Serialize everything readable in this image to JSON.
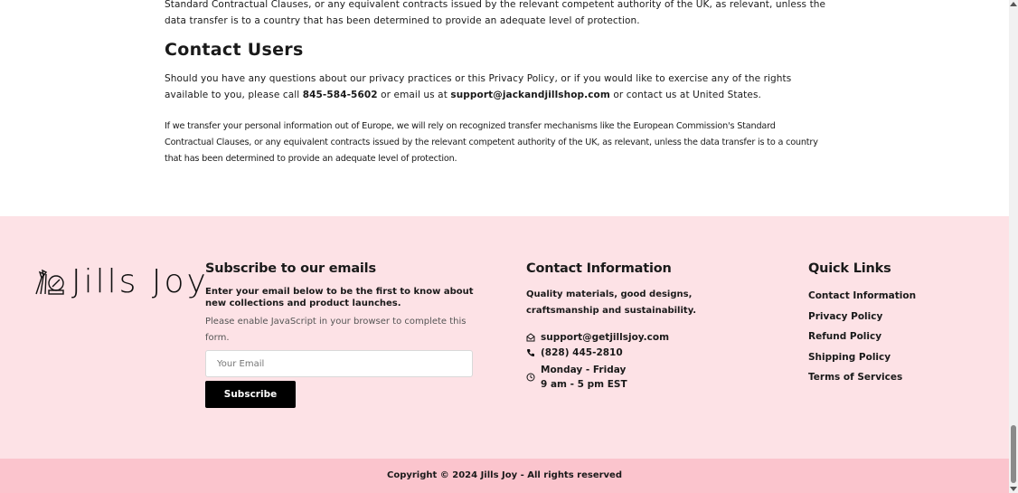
{
  "policy": {
    "top_paragraph": "Standard Contractual Clauses, or any equivalent contracts issued by the relevant competent authority of the UK, as relevant, unless the data transfer is to a country that has been determined to provide an adequate level of protection.",
    "contact_heading": "Contact Users",
    "contact_p_start": "Should you have any questions about our privacy practices or this Privacy Policy, or if you would like to exercise any of the rights available to you, please call ",
    "phone": "845-584-5602",
    "contact_p_mid": " or email us at ",
    "email": "support@jackandjillshop.com",
    "contact_p_end": " or contact us at United States.",
    "transfer_paragraph": "If we transfer your personal information out of Europe, we will rely on recognized transfer mechanisms like the European Commission's Standard Contractual Clauses, or any equivalent contracts issued by the relevant competent authority of the UK, as relevant, unless the data transfer is to a country that has been determined to provide an adequate level of protection."
  },
  "footer": {
    "logo_text": "Jills Joy",
    "subscribe": {
      "title": "Subscribe to our emails",
      "description": "Enter your email below to be the first to know about new collections and product launches.",
      "js_notice": "Please enable JavaScript in your browser to complete this form.",
      "email_placeholder": "Your Email",
      "button_label": "Subscribe"
    },
    "contact": {
      "title": "Contact Information",
      "description": "Quality materials, good designs, craftsmanship and sustainability.",
      "email": "support@getjillsjoy.com",
      "phone": "(828) 445-2810",
      "hours_days": "Monday - Friday",
      "hours_time": "9 am - 5 pm EST"
    },
    "quick_links": {
      "title": "Quick Links",
      "items": [
        "Contact Information",
        "Privacy Policy",
        "Refund Policy",
        "Shipping Policy",
        "Terms of Services"
      ]
    },
    "copyright": "Copyright © 2024 Jills Joy - All rights reserved"
  },
  "colors": {
    "footer_bg": "#fde2e6",
    "copyright_bg": "#fbc4cd",
    "button_bg": "#000000"
  },
  "icons": {
    "email": "envelope-icon",
    "phone": "phone-icon",
    "hours": "clock-icon"
  }
}
